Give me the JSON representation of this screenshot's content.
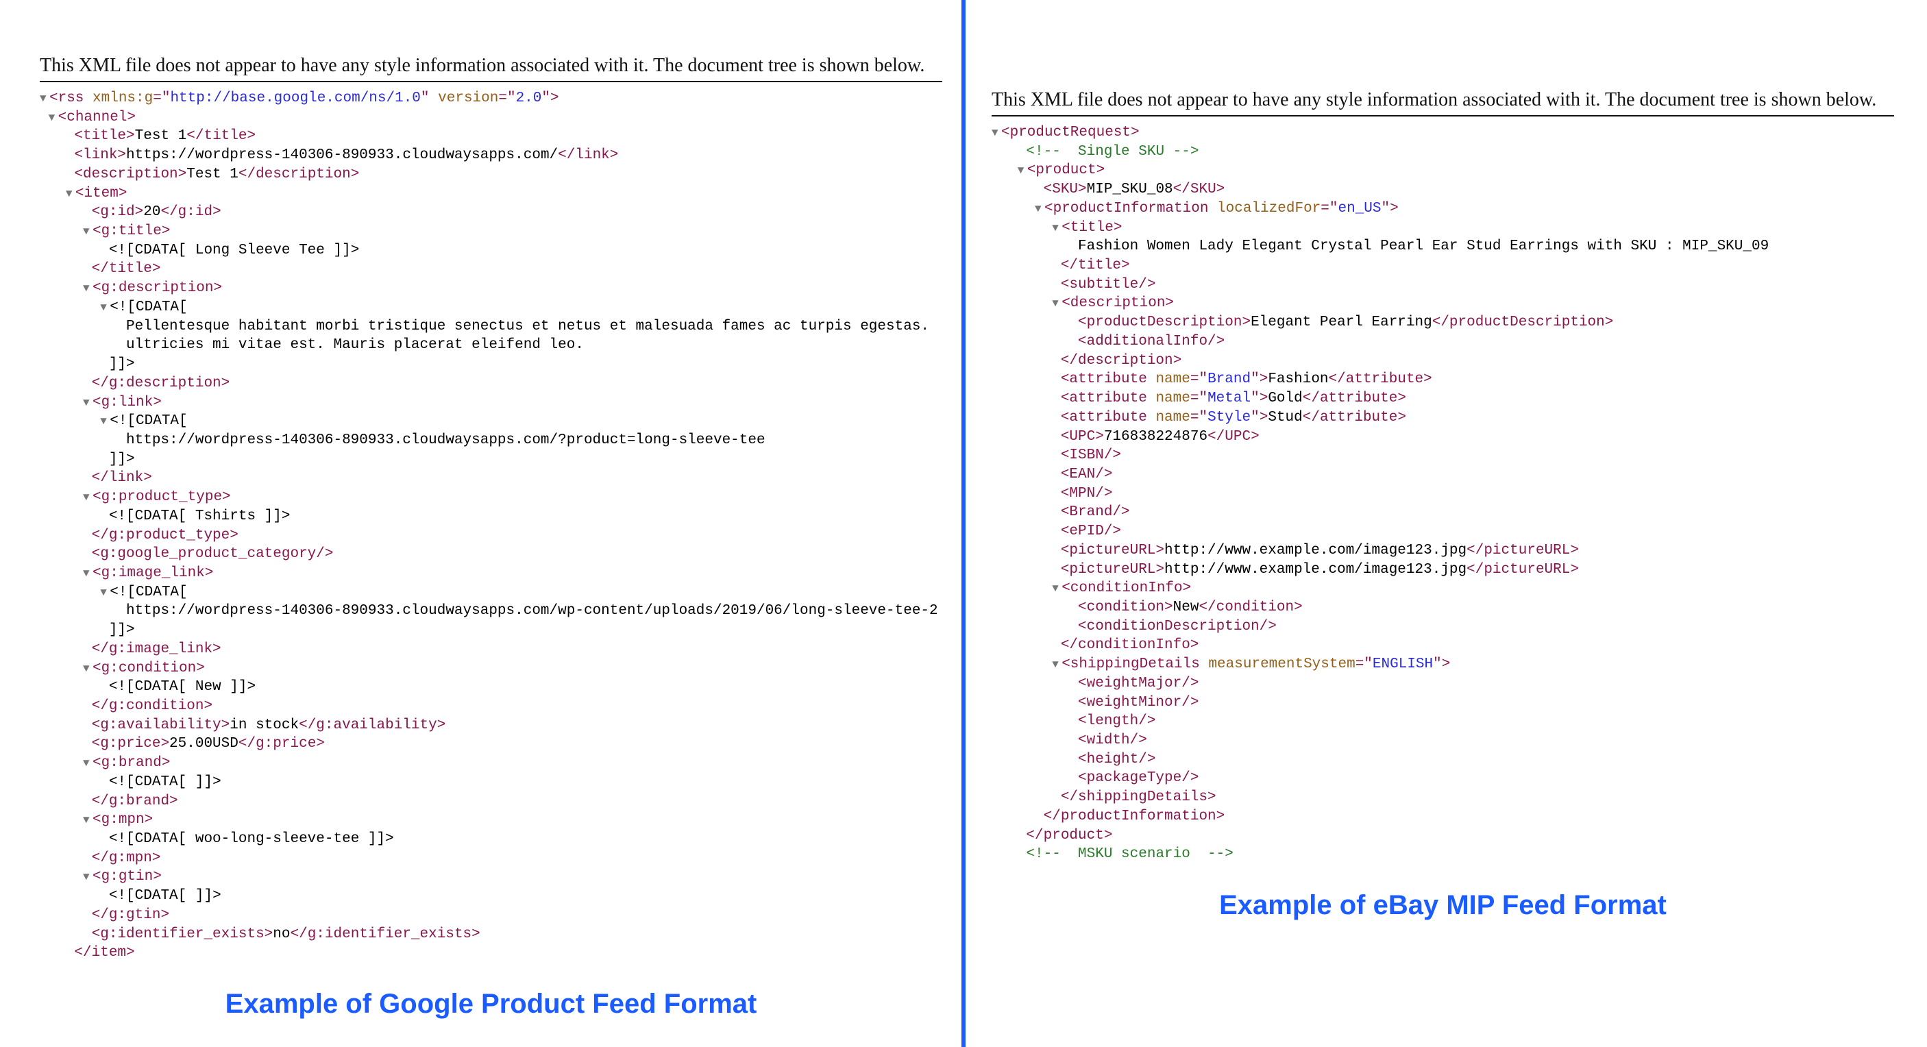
{
  "notice": "This XML file does not appear to have any style information associated with it. The document tree is shown below.",
  "left": {
    "caption": "Example of Google Product Feed Format",
    "rss_ns_attr": "xmlns:g",
    "rss_ns_val": "http://base.google.com/ns/1.0",
    "rss_ver_attr": "version",
    "rss_ver_val": "2.0",
    "ch_title": "Test 1",
    "ch_link": "https://wordpress-140306-890933.cloudwaysapps.com/",
    "ch_desc": "Test 1",
    "gid": "20",
    "item_title_cdata": " Long Sleeve Tee ",
    "desc_l1": "Pellentesque habitant morbi tristique senectus et netus et malesuada fames ac turpis egestas. ",
    "desc_l2": "ultricies mi vitae est. Mauris placerat eleifend leo.",
    "link_cdata": "https://wordpress-140306-890933.cloudwaysapps.com/?product=long-sleeve-tee",
    "ptype_cdata": " Tshirts ",
    "img_cdata": "https://wordpress-140306-890933.cloudwaysapps.com/wp-content/uploads/2019/06/long-sleeve-tee-2",
    "cond_cdata": " New ",
    "avail": "in stock",
    "price": "25.00USD",
    "brand_cdata": " ",
    "mpn_cdata": " woo-long-sleeve-tee ",
    "gtin_cdata": " ",
    "ident_exists": "no"
  },
  "right": {
    "caption": "Example of eBay MIP Feed Format",
    "cm1": "  Single SKU ",
    "sku": "MIP_SKU_08",
    "pi_attr": "localizedFor",
    "pi_val": "en_US",
    "title": "Fashion Women Lady Elegant Crystal Pearl Ear Stud Earrings with SKU : MIP_SKU_09",
    "pdesc": "Elegant Pearl Earring",
    "attr1_name": "Brand",
    "attr1_val": "Fashion",
    "attr2_name": "Metal",
    "attr2_val": "Gold",
    "attr3_name": "Style",
    "attr3_val": "Stud",
    "upc": "716838224876",
    "pic1": "http://www.example.com/image123.jpg",
    "pic2": "http://www.example.com/image123.jpg",
    "cond": "New",
    "sd_attr": "measurementSystem",
    "sd_val": "ENGLISH",
    "cm2": "  MSKU scenario  "
  }
}
